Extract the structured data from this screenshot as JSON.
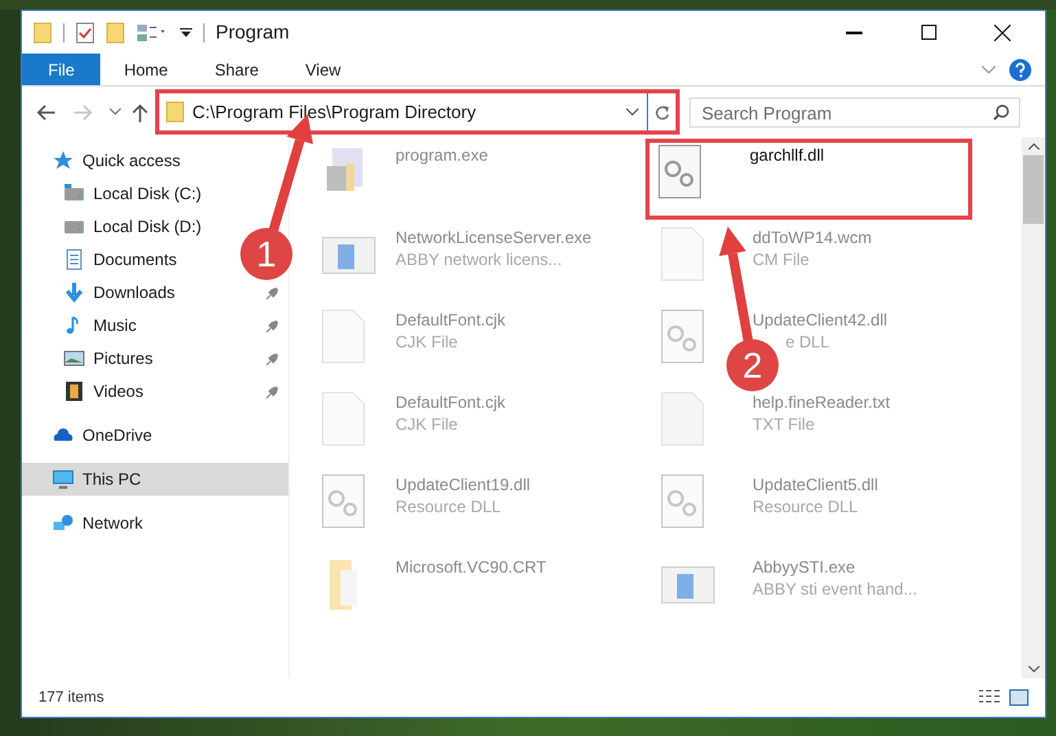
{
  "window": {
    "title": "Program"
  },
  "ribbon_tabs": [
    {
      "label": "File",
      "selected": true
    },
    {
      "label": "Home",
      "selected": false
    },
    {
      "label": "Share",
      "selected": false
    },
    {
      "label": "View",
      "selected": false
    }
  ],
  "address_bar": {
    "path": "C:\\Program Files\\Program Directory",
    "highlighted": true
  },
  "search": {
    "placeholder": "Search Program"
  },
  "sidebar": {
    "items": [
      {
        "label": "Quick access",
        "pinned": false,
        "selected": false
      },
      {
        "label": "Local Disk (C:)",
        "pinned": false,
        "selected": false
      },
      {
        "label": "Local Disk (D:)",
        "pinned": false,
        "selected": false
      },
      {
        "label": "Documents",
        "pinned": false,
        "selected": false
      },
      {
        "label": "Downloads",
        "pinned": true,
        "selected": false
      },
      {
        "label": "Music",
        "pinned": true,
        "selected": false
      },
      {
        "label": "Pictures",
        "pinned": true,
        "selected": false
      },
      {
        "label": "Videos",
        "pinned": true,
        "selected": false
      },
      {
        "label": "OneDrive",
        "pinned": false,
        "selected": false
      },
      {
        "label": "This PC",
        "pinned": false,
        "selected": true
      },
      {
        "label": "Network",
        "pinned": false,
        "selected": false
      }
    ]
  },
  "files": [
    {
      "name": "program.exe",
      "highlighted": false
    },
    {
      "name": "garchllf.dll",
      "highlighted": true
    },
    {
      "name": "NetworkLicenseServer.exe",
      "type": "ABBY network licens...",
      "highlighted": false
    },
    {
      "name": "ddToWP14.wcm",
      "type": "CM File",
      "highlighted": false
    },
    {
      "name": "DefaultFont.cjk",
      "type": "CJK File",
      "highlighted": false
    },
    {
      "name": "UpdateClient42.dll",
      "type": "e DLL",
      "highlighted": false
    },
    {
      "name": "DefaultFont.cjk",
      "type": "CJK File",
      "highlighted": false
    },
    {
      "name": "help.fineReader.txt",
      "type": "TXT File",
      "highlighted": false
    },
    {
      "name": "UpdateClient19.dll",
      "type": "Resource DLL",
      "highlighted": false
    },
    {
      "name": "UpdateClient5.dll",
      "type": "Resource DLL",
      "highlighted": false
    },
    {
      "name": "Microsoft.VC90.CRT",
      "highlighted": false
    },
    {
      "name": "AbbyySTI.exe",
      "type": "ABBY sti event hand...",
      "highlighted": false
    }
  ],
  "status_bar": {
    "item_count": "177 items"
  },
  "annotations": [
    {
      "label": "1"
    },
    {
      "label": "2"
    }
  ]
}
